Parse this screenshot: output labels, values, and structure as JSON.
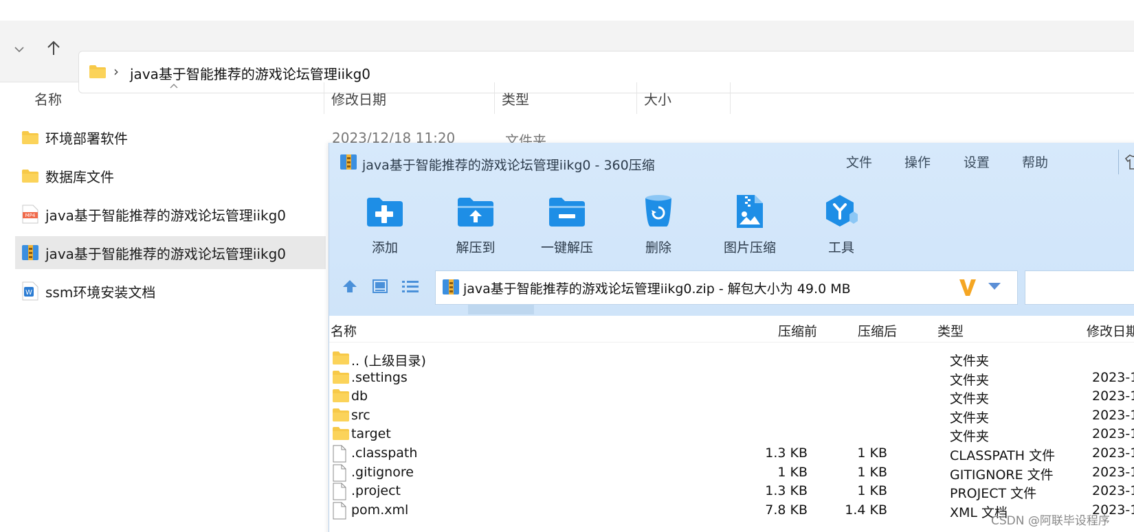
{
  "explorer": {
    "address_path": "java基于智能推荐的游戏论坛管理iikg0",
    "address_separator": "›",
    "columns": {
      "name": "名称",
      "modified": "修改日期",
      "type": "类型",
      "size": "大小"
    },
    "files": [
      {
        "name": "环境部署软件",
        "icon": "folder-icon"
      },
      {
        "name": "数据库文件",
        "icon": "folder-icon"
      },
      {
        "name": "java基于智能推荐的游戏论坛管理iikg0",
        "icon": "mp4-file-icon"
      },
      {
        "name": "java基于智能推荐的游戏论坛管理iikg0",
        "icon": "zip-archive-icon",
        "selected": true
      },
      {
        "name": "ssm环境安装文档",
        "icon": "word-doc-icon"
      }
    ],
    "first_row_date": "2023/12/18 11:20",
    "first_row_type": "文件夹"
  },
  "zipwin": {
    "title": "java基于智能推荐的游戏论坛管理iikg0 - 360压缩",
    "menu": [
      "文件",
      "操作",
      "设置",
      "帮助"
    ],
    "toolbar": [
      {
        "label": "添加",
        "icon": "add-folder-icon"
      },
      {
        "label": "解压到",
        "icon": "extract-to-icon"
      },
      {
        "label": "一键解压",
        "icon": "one-click-extract-icon"
      },
      {
        "label": "删除",
        "icon": "recycle-bin-icon"
      },
      {
        "label": "图片压缩",
        "icon": "image-compress-icon"
      },
      {
        "label": "工具",
        "icon": "tools-icon"
      }
    ],
    "path_text": "java基于智能推荐的游戏论坛管理iikg0.zip - 解包大小为 49.0 MB",
    "columns": {
      "name": "名称",
      "before": "压缩前",
      "after": "压缩后",
      "type": "类型",
      "modified": "修改日期"
    },
    "rows": [
      {
        "name": ".. (上级目录)",
        "before": "",
        "after": "",
        "type": "文件夹",
        "date": "",
        "kind": "folder"
      },
      {
        "name": ".settings",
        "before": "",
        "after": "",
        "type": "文件夹",
        "date": "2023-1",
        "kind": "folder"
      },
      {
        "name": "db",
        "before": "",
        "after": "",
        "type": "文件夹",
        "date": "2023-1",
        "kind": "folder"
      },
      {
        "name": "src",
        "before": "",
        "after": "",
        "type": "文件夹",
        "date": "2023-1",
        "kind": "folder"
      },
      {
        "name": "target",
        "before": "",
        "after": "",
        "type": "文件夹",
        "date": "2023-1",
        "kind": "folder"
      },
      {
        "name": ".classpath",
        "before": "1.3 KB",
        "after": "1 KB",
        "type": "CLASSPATH 文件",
        "date": "2023-1",
        "kind": "file"
      },
      {
        "name": ".gitignore",
        "before": "1 KB",
        "after": "1 KB",
        "type": "GITIGNORE 文件",
        "date": "2023-1",
        "kind": "file"
      },
      {
        "name": ".project",
        "before": "1.3 KB",
        "after": "1 KB",
        "type": "PROJECT 文件",
        "date": "2023-1",
        "kind": "file"
      },
      {
        "name": "pom.xml",
        "before": "7.8 KB",
        "after": "1.4 KB",
        "type": "XML 文档",
        "date": "2023-1",
        "kind": "file"
      }
    ]
  },
  "watermark": "CSDN @阿联毕设程序",
  "colors": {
    "zip_bg": "#d7e9fb",
    "tool_blue": "#1e8ee6",
    "folder_yellow": "#f7c948",
    "v_gold": "#f5a623"
  }
}
